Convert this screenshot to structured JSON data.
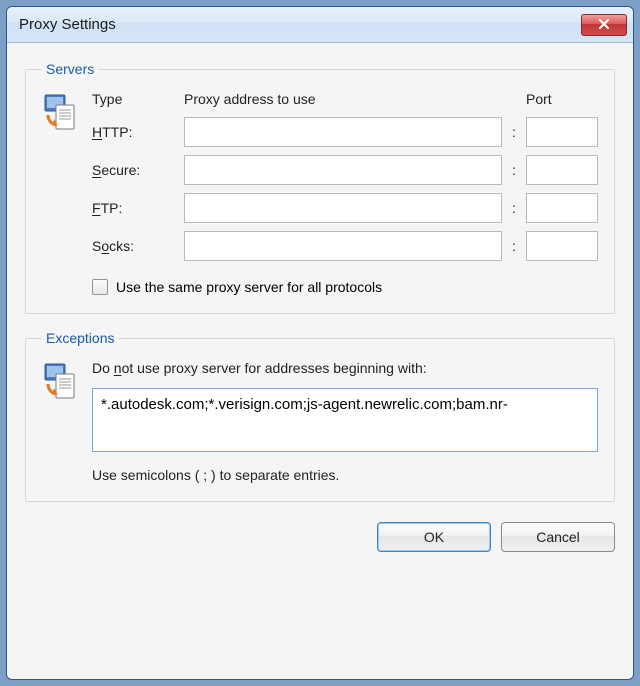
{
  "window": {
    "title": "Proxy Settings"
  },
  "servers": {
    "legend": "Servers",
    "headers": {
      "type": "Type",
      "address": "Proxy address to use",
      "port": "Port"
    },
    "rows": {
      "http": {
        "label_pre": "",
        "label_u": "H",
        "label_post": "TTP:",
        "address": "",
        "port": ""
      },
      "secure": {
        "label_pre": "",
        "label_u": "S",
        "label_post": "ecure:",
        "address": "",
        "port": ""
      },
      "ftp": {
        "label_pre": "",
        "label_u": "F",
        "label_post": "TP:",
        "address": "",
        "port": ""
      },
      "socks": {
        "label_pre": "S",
        "label_u": "o",
        "label_post": "cks:",
        "address": "",
        "port": ""
      }
    },
    "same_for_all": {
      "checked": false,
      "label_pre": "",
      "label_u": "U",
      "label_post": "se the same proxy server for all protocols"
    }
  },
  "exceptions": {
    "legend": "Exceptions",
    "label_pre": "Do ",
    "label_u": "n",
    "label_post": "ot use proxy server for addresses beginning with:",
    "value": "*.autodesk.com;*.verisign.com;js-agent.newrelic.com;bam.nr-",
    "hint": "Use semicolons ( ; ) to separate entries."
  },
  "buttons": {
    "ok": "OK",
    "cancel": "Cancel"
  }
}
